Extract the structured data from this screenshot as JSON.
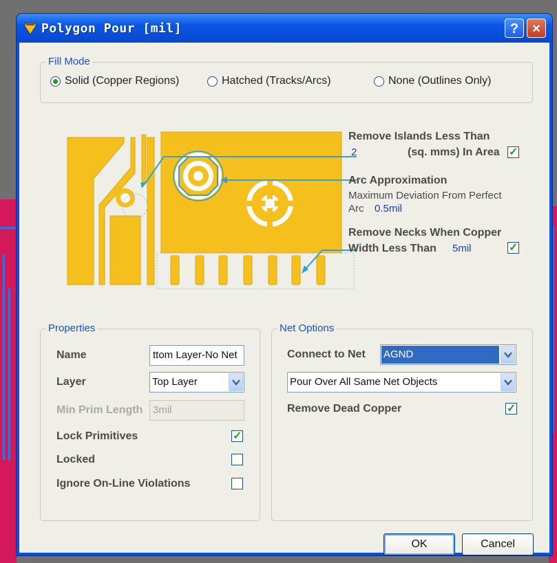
{
  "window": {
    "title": "Polygon Pour [mil]",
    "help_label": "?",
    "close_label": "×"
  },
  "fill_mode": {
    "title": "Fill Mode",
    "options": [
      {
        "label": "Solid (Copper Regions)",
        "selected": true
      },
      {
        "label": "Hatched (Tracks/Arcs)",
        "selected": false
      },
      {
        "label": "None (Outlines Only)",
        "selected": false
      }
    ]
  },
  "preview": {
    "remove_islands_label": "Remove Islands Less Than",
    "remove_islands_value": "2",
    "remove_islands_unit": "(sq. mms) In Area",
    "remove_islands_checked": true,
    "arc_approx_label": "Arc Approximation",
    "arc_approx_desc1": "Maximum Deviation From Perfect",
    "arc_approx_desc2": "Arc",
    "arc_approx_value": "0.5mil",
    "necks_label1": "Remove Necks When Copper",
    "necks_label2": "Width Less Than",
    "necks_value": "5mil",
    "necks_checked": true,
    "copper_color": "#f5c01e",
    "accent_color": "#3c9fc8"
  },
  "properties": {
    "title": "Properties",
    "name_label": "Name",
    "name_value": "ttom Layer-No Net",
    "layer_label": "Layer",
    "layer_value": "Top Layer",
    "min_prim_label": "Min Prim Length",
    "min_prim_value": "3mil",
    "lock_primitives_label": "Lock Primitives",
    "lock_primitives_checked": true,
    "locked_label": "Locked",
    "locked_checked": false,
    "ignore_label": "Ignore On-Line Violations",
    "ignore_checked": false
  },
  "net_options": {
    "title": "Net Options",
    "connect_label": "Connect to Net",
    "connect_value": "AGND",
    "pour_value": "Pour Over All Same Net Objects",
    "dead_copper_label": "Remove Dead Copper",
    "dead_copper_checked": true
  },
  "buttons": {
    "ok": "OK",
    "cancel": "Cancel"
  }
}
